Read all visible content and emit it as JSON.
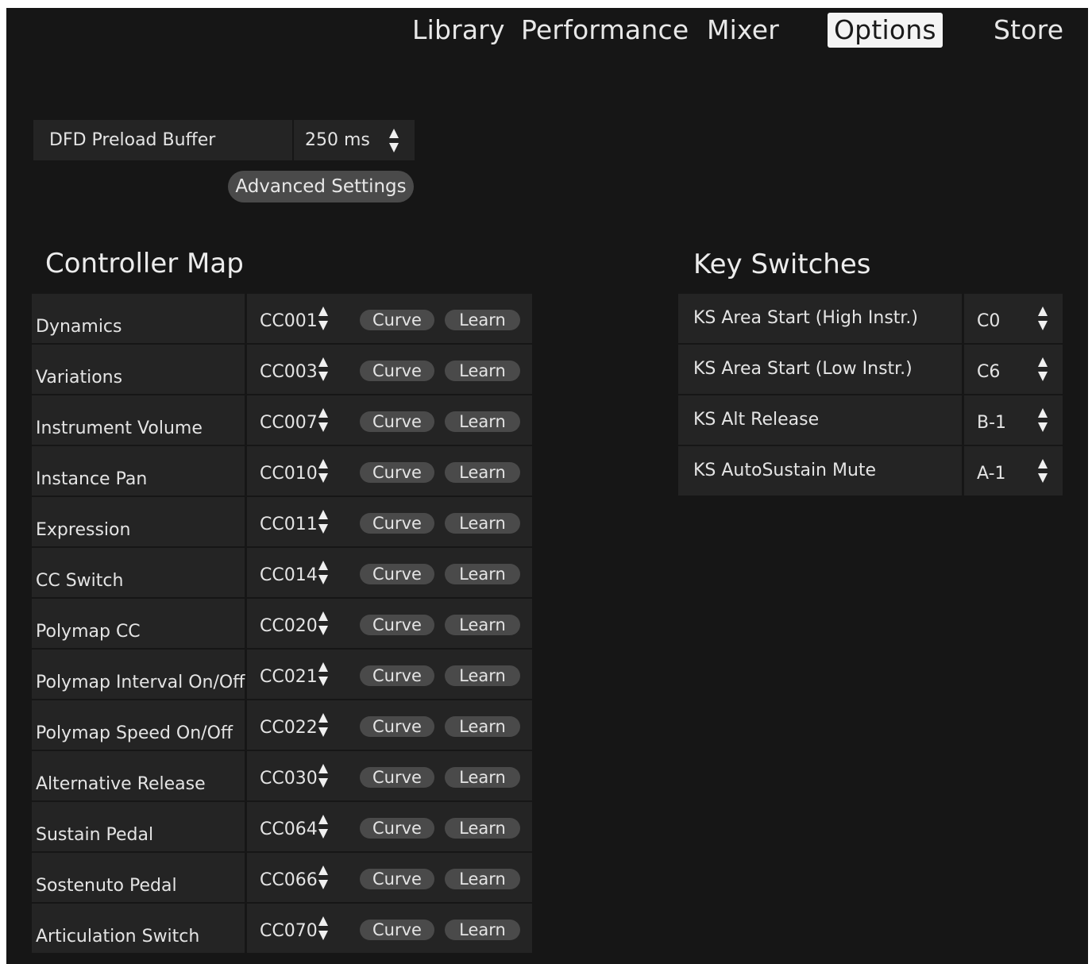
{
  "nav": {
    "tabs": [
      {
        "label": "Library"
      },
      {
        "label": "Performance"
      },
      {
        "label": "Mixer"
      },
      {
        "label": "Options",
        "active": true
      },
      {
        "label": "Store"
      }
    ]
  },
  "dfd": {
    "label": "DFD Preload Buffer",
    "value": "250 ms",
    "advanced_button": "Advanced Settings"
  },
  "controller_map": {
    "title": "Controller Map",
    "curve_label": "Curve",
    "learn_label": "Learn",
    "rows": [
      {
        "name": "Dynamics",
        "cc": "CC001"
      },
      {
        "name": "Variations",
        "cc": "CC003"
      },
      {
        "name": "Instrument Volume",
        "cc": "CC007"
      },
      {
        "name": "Instance Pan",
        "cc": "CC010"
      },
      {
        "name": "Expression",
        "cc": "CC011"
      },
      {
        "name": "CC Switch",
        "cc": "CC014"
      },
      {
        "name": "Polymap CC",
        "cc": "CC020"
      },
      {
        "name": "Polymap Interval On/Off",
        "cc": "CC021"
      },
      {
        "name": "Polymap Speed On/Off",
        "cc": "CC022"
      },
      {
        "name": "Alternative Release",
        "cc": "CC030"
      },
      {
        "name": "Sustain Pedal",
        "cc": "CC064"
      },
      {
        "name": "Sostenuto Pedal",
        "cc": "CC066"
      },
      {
        "name": "Articulation Switch",
        "cc": "CC070"
      }
    ]
  },
  "key_switches": {
    "title": "Key Switches",
    "rows": [
      {
        "name": "KS Area Start (High Instr.)",
        "value": "C0"
      },
      {
        "name": "KS Area Start (Low  Instr.)",
        "value": "C6"
      },
      {
        "name": "KS Alt Release",
        "value": "B-1"
      },
      {
        "name": "KS AutoSustain Mute",
        "value": "A-1"
      }
    ]
  },
  "colors": {
    "background": "#161616",
    "panel": "#242424",
    "pill": "#4a4a4a",
    "text": "#e4e4e4",
    "active_tab_bg": "#f4f4f4"
  },
  "icons": {
    "stepper": "up-down-arrows-icon"
  }
}
